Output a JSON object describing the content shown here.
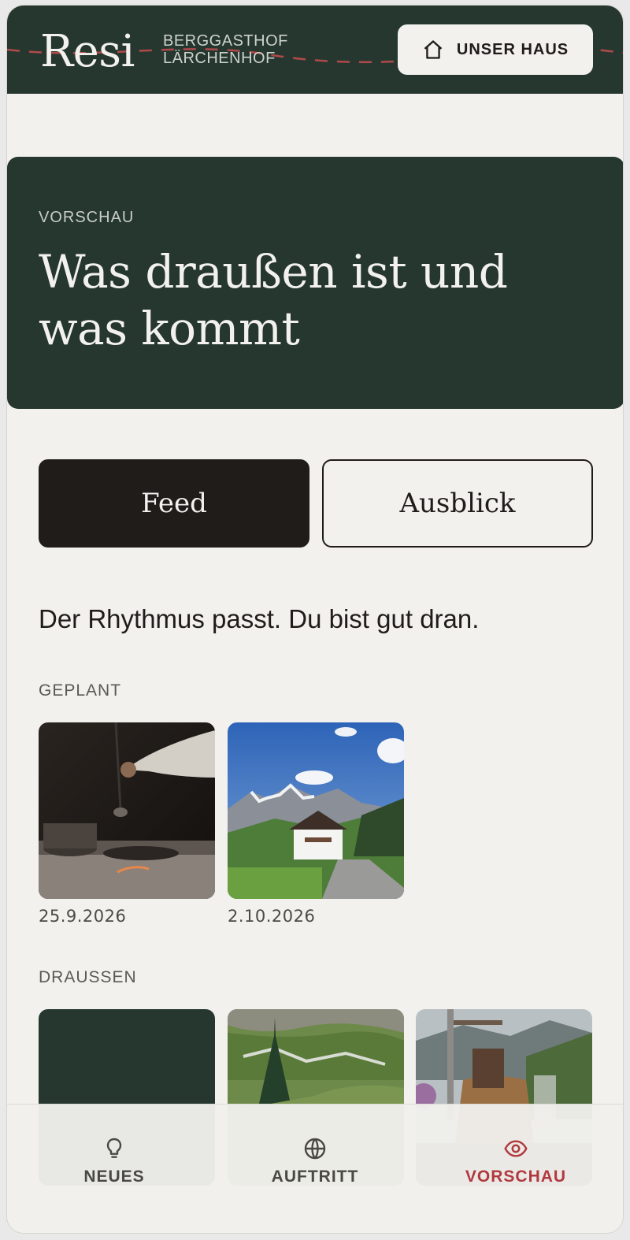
{
  "header": {
    "logo": "Resi",
    "subtitle_line1": "BERGGASTHOF",
    "subtitle_line2": "LÄRCHENHOF",
    "house_button": "UNSER HAUS"
  },
  "hero": {
    "eyebrow": "VORSCHAU",
    "title": "Was draußen ist und was kommt"
  },
  "tabs": [
    {
      "label": "Feed",
      "active": true
    },
    {
      "label": "Ausblick",
      "active": false
    }
  ],
  "message": "Der Rhythmus passt. Du bist gut dran.",
  "sections": {
    "planned": {
      "label": "GEPLANT",
      "items": [
        {
          "image": "kitchen-cooking-photo",
          "date": "25.9.2026"
        },
        {
          "image": "mountain-guesthouse-photo",
          "date": "2.10.2026"
        }
      ]
    },
    "outside": {
      "label": "DRAUSSEN",
      "items": [
        {
          "image": "placeholder-dark-green"
        },
        {
          "image": "alpine-meadow-photo"
        },
        {
          "image": "mountain-terrace-photo"
        }
      ]
    }
  },
  "bottom_nav": [
    {
      "label": "NEUES",
      "icon": "lightbulb-icon",
      "active": false
    },
    {
      "label": "AUFTRITT",
      "icon": "globe-icon",
      "active": false
    },
    {
      "label": "VORSCHAU",
      "icon": "eye-icon",
      "active": true
    }
  ],
  "colors": {
    "forest": "#25372f",
    "background": "#f2f1ee",
    "ink": "#1f1c1a",
    "accent": "#b0393e"
  }
}
